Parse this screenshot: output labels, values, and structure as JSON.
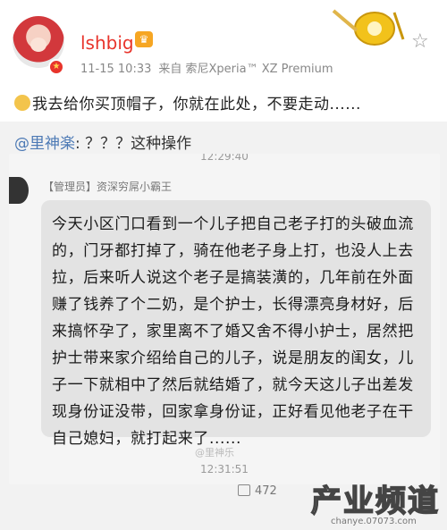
{
  "header": {
    "username": "lshbig",
    "timestamp": "11-15 10:33",
    "source": "来自 索尼Xperia™ XZ Premium",
    "favorite_icon": "star-outline"
  },
  "post": {
    "text": "我去给你买顶帽子，你就在此处，不要走动......"
  },
  "repost": {
    "mention": "@里神楽",
    "text": ": ？？？这种操作",
    "screenshot": {
      "time_top": "12:29:40",
      "sender": "【管理员】资深穷屌小霸王",
      "message": "今天小区门口看到一个儿子把自己老子打的头破血流的，门牙都打掉了，骑在他老子身上打，也没人上去拉，后来听人说这个老子是搞装潢的，几年前在外面赚了钱养了个二奶，是个护士，长得漂亮身材好，后来搞怀孕了，家里离不了婚又舍不得小护士，居然把护士带来家介绍给自己的儿子，说是朋友的闺女，儿子一下就相中了然后就结婚了，就今天这儿子出差发现身份证没带，回家拿身份证，正好看见他老子在干自己媳妇，就打起来了......",
      "time_bottom": "12:31:51",
      "watermark": "@里神乐"
    }
  },
  "footer": {
    "share_count": "472",
    "site_logo": "产业频道",
    "site_url": "chanye.07073.com"
  },
  "colors": {
    "username": "#e8342b",
    "mention": "#4d7ab5",
    "repost_bg": "#f2f2f2",
    "bubble_bg": "#e3e3e3"
  }
}
